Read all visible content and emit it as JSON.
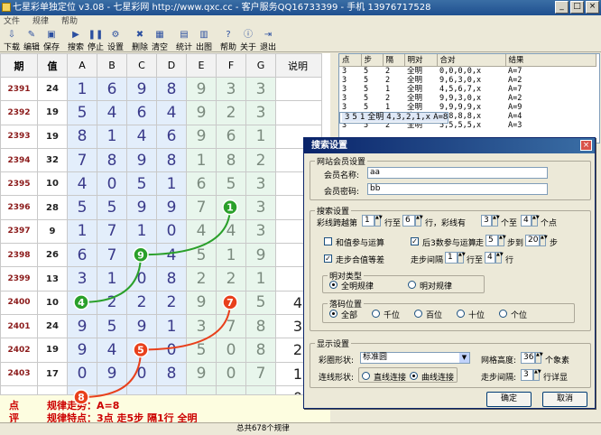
{
  "app": {
    "title": "七星彩单独定位 v3.08 - 七星彩网 http://www.qxc.cc - 客户服务QQ16733399 - 手机 13976717528"
  },
  "menu": [
    "文件",
    "规律",
    "帮助"
  ],
  "toolbar": [
    {
      "label": "下载",
      "icon": "download-icon"
    },
    {
      "label": "编辑",
      "icon": "edit-icon"
    },
    {
      "label": "保存",
      "icon": "save-icon"
    },
    {
      "label": "搜索",
      "icon": "play-icon"
    },
    {
      "label": "停止",
      "icon": "pause-icon"
    },
    {
      "label": "设置",
      "icon": "settings-icon"
    },
    {
      "label": "删除",
      "icon": "delete-icon"
    },
    {
      "label": "清空",
      "icon": "clear-icon"
    },
    {
      "label": "统计",
      "icon": "stats-icon"
    },
    {
      "label": "出图",
      "icon": "chart-icon"
    },
    {
      "label": "帮助",
      "icon": "help-icon"
    },
    {
      "label": "关于",
      "icon": "about-icon"
    },
    {
      "label": "退出",
      "icon": "exit-icon"
    }
  ],
  "grid": {
    "headers": [
      "期",
      "值",
      "A",
      "B",
      "C",
      "D",
      "E",
      "F",
      "G",
      "说明"
    ],
    "rows": [
      {
        "period": "2391",
        "value": "24",
        "digits": [
          "1",
          "6",
          "9",
          "8",
          "9",
          "3",
          "3"
        ],
        "note": ""
      },
      {
        "period": "2392",
        "value": "19",
        "digits": [
          "5",
          "4",
          "6",
          "4",
          "9",
          "2",
          "3"
        ],
        "note": ""
      },
      {
        "period": "2393",
        "value": "19",
        "digits": [
          "8",
          "1",
          "4",
          "6",
          "9",
          "6",
          "1"
        ],
        "note": ""
      },
      {
        "period": "2394",
        "value": "32",
        "digits": [
          "7",
          "8",
          "9",
          "8",
          "1",
          "8",
          "2"
        ],
        "note": ""
      },
      {
        "period": "2395",
        "value": "10",
        "digits": [
          "4",
          "0",
          "5",
          "1",
          "6",
          "5",
          "3"
        ],
        "note": ""
      },
      {
        "period": "2396",
        "value": "28",
        "digits": [
          "5",
          "5",
          "9",
          "9",
          "7",
          "",
          "3"
        ],
        "note": ""
      },
      {
        "period": "2397",
        "value": "9",
        "digits": [
          "1",
          "7",
          "1",
          "0",
          "4",
          "4",
          "3"
        ],
        "note": ""
      },
      {
        "period": "2398",
        "value": "26",
        "digits": [
          "6",
          "7",
          "",
          "4",
          "5",
          "1",
          "9"
        ],
        "note": ""
      },
      {
        "period": "2399",
        "value": "13",
        "digits": [
          "3",
          "1",
          "0",
          "8",
          "2",
          "2",
          "1"
        ],
        "note": ""
      },
      {
        "period": "2400",
        "value": "10",
        "digits": [
          "",
          "2",
          "2",
          "2",
          "9",
          "",
          "5"
        ],
        "note": "4"
      },
      {
        "period": "2401",
        "value": "24",
        "digits": [
          "9",
          "5",
          "9",
          "1",
          "3",
          "7",
          "8"
        ],
        "note": "3"
      },
      {
        "period": "2402",
        "value": "19",
        "digits": [
          "9",
          "4",
          "",
          "0",
          "5",
          "0",
          "8"
        ],
        "note": "2"
      },
      {
        "period": "2403",
        "value": "17",
        "digits": [
          "0",
          "9",
          "0",
          "8",
          "9",
          "0",
          "7"
        ],
        "note": "1"
      },
      {
        "period": "",
        "value": "",
        "digits": [
          "",
          "",
          "",
          "",
          "",
          "",
          ""
        ],
        "note": "0"
      }
    ]
  },
  "markers": [
    {
      "n": "1",
      "period": "2396",
      "col": "F",
      "color": "#2aa02a"
    },
    {
      "n": "9",
      "period": "2398",
      "col": "C",
      "color": "#2aa02a"
    },
    {
      "n": "4",
      "period": "2400",
      "col": "A",
      "color": "#2aa02a"
    },
    {
      "n": "7",
      "period": "2400",
      "col": "F",
      "color": "#e8401c"
    },
    {
      "n": "5",
      "period": "2402",
      "col": "C",
      "color": "#e8401c"
    },
    {
      "n": "8",
      "period": "2404",
      "col": "A",
      "color": "#e8401c"
    }
  ],
  "legend": {
    "trend_key": "点",
    "trend_text": "规律走势：A=8",
    "feature_key": "评",
    "feature_text": "规律特点：3点 走5步 隔1行 全明"
  },
  "list": {
    "headers": [
      "点",
      "步",
      "隔",
      "明对",
      "合对",
      "结果"
    ],
    "rows": [
      [
        "3",
        "5",
        "2",
        "全明",
        "0,0,0,0,x",
        "A=7"
      ],
      [
        "3",
        "5",
        "2",
        "全明",
        "9,6,3,0,x",
        "A=2"
      ],
      [
        "3",
        "5",
        "1",
        "全明",
        "4,5,6,7,x",
        "A=7"
      ],
      [
        "3",
        "5",
        "2",
        "全明",
        "9,9,3,0,x",
        "A=2"
      ],
      [
        "3",
        "5",
        "1",
        "全明",
        "9,9,9,9,x",
        "A=9"
      ],
      [
        "3",
        "5",
        "1",
        "全明",
        "4,3,2,1,x",
        "A=8"
      ],
      [
        "3",
        "5",
        "1",
        "全明",
        "8,8,8,8,x",
        "A=4"
      ],
      [
        "3",
        "5",
        "2",
        "全明",
        "5,5,5,5,x",
        "A=3"
      ]
    ],
    "selected": 5
  },
  "status": "总共678个规律",
  "dialog": {
    "title": "搜索设置",
    "member_group": "网站会员设置",
    "member_name_label": "会员名称:",
    "member_name": "aa",
    "member_pass_label": "会员密码:",
    "member_pass": "bb",
    "search_group": "搜索设置",
    "span_prefix": "彩线跨越第",
    "span_row_from": "1",
    "span_to": "行至",
    "span_row_to": "6",
    "span_suffix": "行，彩线有",
    "pts_from": "3",
    "pts_to": "个至",
    "pts_max": "4",
    "pts_suffix": "个点",
    "sum_checkbox": "和值参与运算",
    "sum_checked": false,
    "last3_checkbox": "后3数参与运算",
    "last3_checked": true,
    "walk_label": "走",
    "walk_from": "5",
    "walk_to": "步到",
    "walk_max": "20",
    "walk_suffix": "步",
    "walkdiff_checkbox": "走步合值等差",
    "walkdiff_checked": true,
    "gap_label": "走步间隔",
    "gap_from": "1",
    "gap_to": "行至",
    "gap_max": "4",
    "gap_suffix": "行",
    "pair_group": "明对类型",
    "pair_options": [
      "全明规律",
      "明对规律"
    ],
    "pair_selected": 0,
    "pos_group": "落码位置",
    "pos_options": [
      "全部",
      "千位",
      "百位",
      "十位",
      "个位"
    ],
    "pos_selected": 0,
    "display_group": "显示设置",
    "shape_label": "彩圈形状:",
    "shape_value": "标准圆",
    "height_label": "网格高度:",
    "height_value": "36",
    "height_unit": "个象素",
    "line_label": "连线形状:",
    "line_options": [
      "直线连接",
      "曲线连接"
    ],
    "line_selected": 1,
    "step_label": "走步间隔:",
    "step_value": "3",
    "step_unit": "行详显",
    "ok": "确定",
    "cancel": "取消"
  }
}
